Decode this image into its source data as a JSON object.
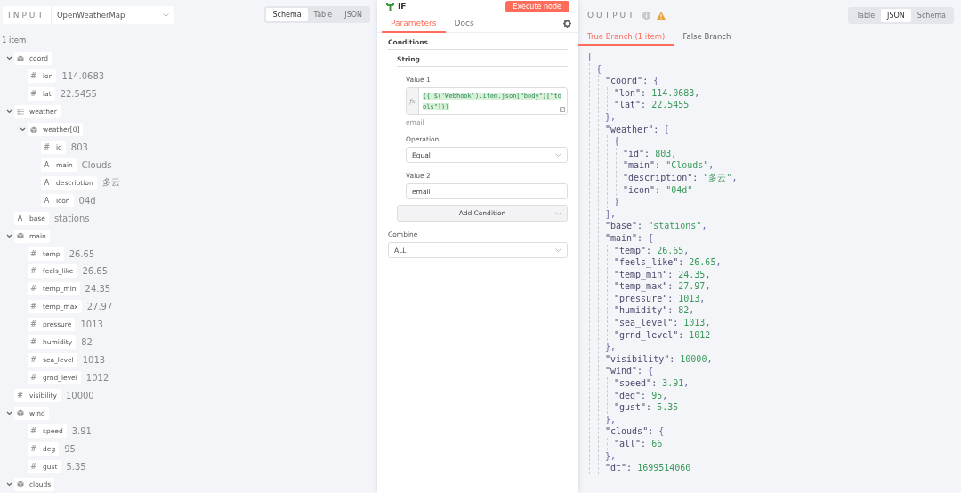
{
  "input": {
    "label": "INPUT",
    "source": "OpenWeatherMap",
    "views": [
      {
        "label": "Schema",
        "selected": true
      },
      {
        "label": "Table",
        "selected": false
      },
      {
        "label": "JSON",
        "selected": false
      }
    ],
    "count": "1 item",
    "tree": [
      {
        "kind": "object",
        "key": "coord",
        "expanded": true,
        "children": [
          {
            "kind": "number",
            "symbol": "#",
            "key": "lon",
            "value": "114.0683"
          },
          {
            "kind": "number",
            "symbol": "#",
            "key": "lat",
            "value": "22.5455"
          }
        ]
      },
      {
        "kind": "array",
        "key": "weather",
        "expanded": true,
        "children": [
          {
            "kind": "object",
            "key": "weather[0]",
            "expanded": true,
            "children": [
              {
                "kind": "number",
                "symbol": "#",
                "key": "id",
                "value": "803"
              },
              {
                "kind": "string",
                "symbol": "A",
                "key": "main",
                "value": "Clouds"
              },
              {
                "kind": "string",
                "symbol": "A",
                "key": "description",
                "value": "多云"
              },
              {
                "kind": "string",
                "symbol": "A",
                "key": "icon",
                "value": "04d"
              }
            ]
          }
        ]
      },
      {
        "kind": "string",
        "symbol": "A",
        "key": "base",
        "value": "stations"
      },
      {
        "kind": "object",
        "key": "main",
        "expanded": true,
        "children": [
          {
            "kind": "number",
            "symbol": "#",
            "key": "temp",
            "value": "26.65"
          },
          {
            "kind": "number",
            "symbol": "#",
            "key": "feels_like",
            "value": "26.65"
          },
          {
            "kind": "number",
            "symbol": "#",
            "key": "temp_min",
            "value": "24.35"
          },
          {
            "kind": "number",
            "symbol": "#",
            "key": "temp_max",
            "value": "27.97"
          },
          {
            "kind": "number",
            "symbol": "#",
            "key": "pressure",
            "value": "1013"
          },
          {
            "kind": "number",
            "symbol": "#",
            "key": "humidity",
            "value": "82"
          },
          {
            "kind": "number",
            "symbol": "#",
            "key": "sea_level",
            "value": "1013"
          },
          {
            "kind": "number",
            "symbol": "#",
            "key": "grnd_level",
            "value": "1012"
          }
        ]
      },
      {
        "kind": "number",
        "symbol": "#",
        "key": "visibility",
        "value": "10000"
      },
      {
        "kind": "object",
        "key": "wind",
        "expanded": true,
        "children": [
          {
            "kind": "number",
            "symbol": "#",
            "key": "speed",
            "value": "3.91"
          },
          {
            "kind": "number",
            "symbol": "#",
            "key": "deg",
            "value": "95"
          },
          {
            "kind": "number",
            "symbol": "#",
            "key": "gust",
            "value": "5.35"
          }
        ]
      },
      {
        "kind": "object",
        "key": "clouds",
        "expanded": true
      }
    ]
  },
  "node": {
    "title": "IF",
    "execute_button": "Execute node",
    "tabs": [
      {
        "label": "Parameters",
        "selected": true
      },
      {
        "label": "Docs",
        "selected": false
      }
    ],
    "section": "Conditions",
    "subsection": "String",
    "value1": {
      "label": "Value 1",
      "fx": "fx",
      "expression": "{{ $('Webhook').item.json[\"body\"][\"tools\"]}}",
      "hint": "email"
    },
    "operation": {
      "label": "Operation",
      "value": "Equal"
    },
    "value2": {
      "label": "Value 2",
      "value": "email"
    },
    "add_condition": "Add Condition",
    "combine": {
      "label": "Combine",
      "value": "ALL"
    }
  },
  "output": {
    "label": "OUTPUT",
    "warning": true,
    "views": [
      {
        "label": "Table",
        "selected": false
      },
      {
        "label": "JSON",
        "selected": true
      },
      {
        "label": "Schema",
        "selected": false
      }
    ],
    "branches": [
      {
        "label": "True Branch (1 item)",
        "selected": true
      },
      {
        "label": "False Branch",
        "selected": false
      }
    ],
    "json_view": {
      "open": "[",
      "children": [
        {
          "open": "{",
          "children": [
            {
              "key": "\"coord\":",
              "open": "{",
              "close": "}",
              "punct": ",",
              "children": [
                {
                  "key": "\"lon\":",
                  "value": "114.0683",
                  "punct": ","
                },
                {
                  "key": "\"lat\":",
                  "value": "22.5455"
                }
              ]
            },
            {
              "key": "\"weather\":",
              "open": "[",
              "close": "]",
              "punct": ",",
              "children": [
                {
                  "open": "{",
                  "close": "}",
                  "children": [
                    {
                      "key": "\"id\":",
                      "value": "803",
                      "punct": ","
                    },
                    {
                      "key": "\"main\":",
                      "value": "\"Clouds\"",
                      "punct": ","
                    },
                    {
                      "key": "\"description\":",
                      "value": "\"多云\"",
                      "punct": ","
                    },
                    {
                      "key": "\"icon\":",
                      "value": "\"04d\""
                    }
                  ]
                }
              ]
            },
            {
              "key": "\"base\":",
              "value": "\"stations\"",
              "punct": ","
            },
            {
              "key": "\"main\":",
              "open": "{",
              "close": "}",
              "punct": ",",
              "children": [
                {
                  "key": "\"temp\":",
                  "value": "26.65",
                  "punct": ","
                },
                {
                  "key": "\"feels_like\":",
                  "value": "26.65",
                  "punct": ","
                },
                {
                  "key": "\"temp_min\":",
                  "value": "24.35",
                  "punct": ","
                },
                {
                  "key": "\"temp_max\":",
                  "value": "27.97",
                  "punct": ","
                },
                {
                  "key": "\"pressure\":",
                  "value": "1013",
                  "punct": ","
                },
                {
                  "key": "\"humidity\":",
                  "value": "82",
                  "punct": ","
                },
                {
                  "key": "\"sea_level\":",
                  "value": "1013",
                  "punct": ","
                },
                {
                  "key": "\"grnd_level\":",
                  "value": "1012"
                }
              ]
            },
            {
              "key": "\"visibility\":",
              "value": "10000",
              "punct": ","
            },
            {
              "key": "\"wind\":",
              "open": "{",
              "close": "}",
              "punct": ",",
              "children": [
                {
                  "key": "\"speed\":",
                  "value": "3.91",
                  "punct": ","
                },
                {
                  "key": "\"deg\":",
                  "value": "95",
                  "punct": ","
                },
                {
                  "key": "\"gust\":",
                  "value": "5.35"
                }
              ]
            },
            {
              "key": "\"clouds\":",
              "open": "{",
              "close": "}",
              "punct": ",",
              "children": [
                {
                  "key": "\"all\":",
                  "value": "66"
                }
              ]
            },
            {
              "key": "\"dt\":",
              "value": "1699514060"
            }
          ]
        }
      ]
    }
  }
}
